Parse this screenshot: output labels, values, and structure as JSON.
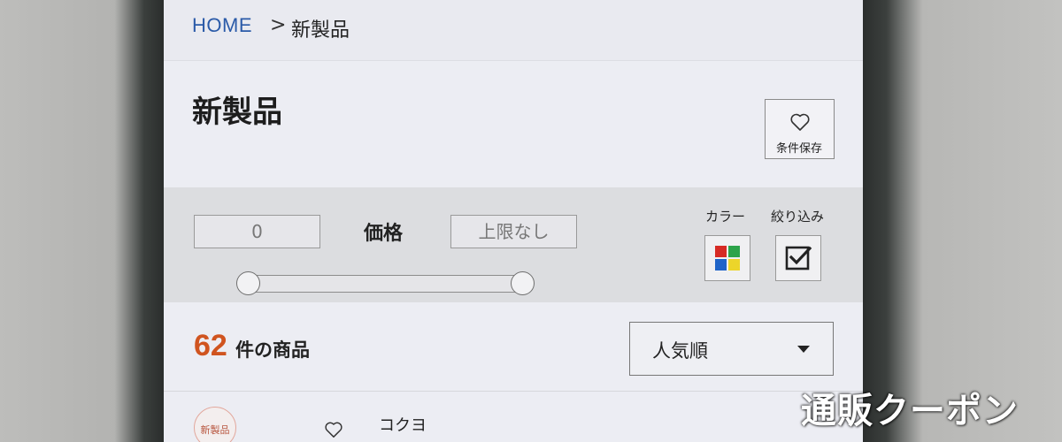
{
  "breadcrumb": {
    "home": "HOME",
    "separator": ">",
    "current": "新製品"
  },
  "page": {
    "title": "新製品"
  },
  "save_condition": {
    "label": "条件保存",
    "icon": "heart-outline-icon"
  },
  "price_filter": {
    "label": "価格",
    "min_value": "0",
    "max_placeholder": "上限なし"
  },
  "color_filter": {
    "label": "カラー",
    "icon": "color-grid-icon",
    "swatches": [
      "#d62a24",
      "#2da34a",
      "#1f64c8",
      "#ecd52a"
    ]
  },
  "refine_filter": {
    "label": "絞り込み",
    "icon": "checkbox-checked-icon"
  },
  "results": {
    "count": "62",
    "suffix": "件の商品"
  },
  "sort": {
    "selected": "人気順"
  },
  "product": {
    "badge": "新製品",
    "brand": "コクヨ",
    "favorite_icon": "heart-outline-icon"
  },
  "watermark": "通販クーポン",
  "colors": {
    "accent_orange": "#d0541f",
    "link_blue": "#2a5aa8"
  }
}
